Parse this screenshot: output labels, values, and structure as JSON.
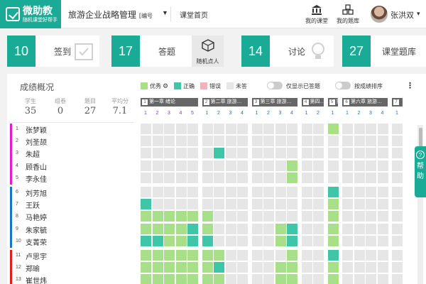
{
  "app": {
    "name": "微助教",
    "slogan": "随机课堂好帮手"
  },
  "header": {
    "course_title": "旅游企业战略管理",
    "course_title_suffix": "[编号",
    "home_label": "课堂首页",
    "my_classes": "我的课堂",
    "my_bank": "我的题库",
    "user_name": "张洪双"
  },
  "cards": [
    {
      "value": "10",
      "label": "签到"
    },
    {
      "value": "17",
      "label": "答题"
    },
    {
      "value": "14",
      "label": "讨论"
    },
    {
      "value": "27",
      "label": "课堂题库"
    }
  ],
  "random_pick": "随机点人",
  "overview": {
    "title": "成绩概况",
    "stats": [
      {
        "label": "学生",
        "value": "35"
      },
      {
        "label": "组卷",
        "value": "0"
      },
      {
        "label": "题目",
        "value": "27"
      },
      {
        "label": "平均分",
        "value": "7.1"
      }
    ]
  },
  "legend": [
    {
      "label": "优秀",
      "color": "#a8e08a"
    },
    {
      "label": "正确",
      "color": "#3ec6a8"
    },
    {
      "label": "错误",
      "color": "#f4b0bb"
    },
    {
      "label": "未答",
      "color": "#e6e6e6"
    }
  ],
  "toggles": [
    {
      "label": "仅显示已答题"
    },
    {
      "label": "按成绩排序"
    }
  ],
  "chapters": [
    {
      "badge": "1",
      "title": "第一章  绪论",
      "questions": [
        "1",
        "2",
        "3",
        "4",
        "5"
      ]
    },
    {
      "badge": "2",
      "title": "第二章  旅游…",
      "questions": [
        "1",
        "2",
        "3",
        "4"
      ]
    },
    {
      "badge": "3",
      "title": "第三章  旅游…",
      "questions": [
        "1",
        "2",
        "3",
        "4"
      ]
    },
    {
      "badge": "4",
      "title": "第四…",
      "questions": [
        "1",
        "2"
      ]
    },
    {
      "badge": "5",
      "title": "第五…",
      "questions": [
        "1"
      ]
    },
    {
      "badge": "6",
      "title": "第六章  旅游…",
      "questions": [
        "1",
        "2",
        "3",
        "4"
      ]
    },
    {
      "badge": "7",
      "title": "",
      "questions": [
        "1"
      ]
    }
  ],
  "question_colors": [
    "#7b3fc2",
    "#7b3fc2",
    "#7b3fc2",
    "#7b3fc2",
    "#7b3fc2",
    "#1a73c9",
    "#1a73c9",
    "#1a73c9",
    "#1a73c9",
    "#1a73c9",
    "#1a73c9",
    "#1a73c9",
    "#1a73c9",
    "#1a73c9",
    "#1a73c9",
    "#1a73c9",
    "#1a73c9",
    "#1a73c9",
    "#1a73c9",
    "#1a73c9",
    "#1a73c9"
  ],
  "students": [
    {
      "idx": "1",
      "name": "张梦颖",
      "group": "#e01fd0",
      "cells": "uuuuu|uuuu|uuuu|uuuu|e|uuuu|u"
    },
    {
      "idx": "2",
      "name": "刘圣颉",
      "group": "#e01fd0",
      "cells": "uuuuu|uuuu|uuuu|uuuu|u|uuuu|u"
    },
    {
      "idx": "3",
      "name": "朱超",
      "group": "#e01fd0",
      "cells": "uuuuu|ucuu|uuuu|uuuu|u|uuuu|u"
    },
    {
      "idx": "4",
      "name": "顾香山",
      "group": "#e01fd0",
      "cells": "uuuuu|uuuu|uuue|uuuu|u|uuuu|u"
    },
    {
      "idx": "5",
      "name": "李永佳",
      "group": "#e01fd0",
      "cells": "uuuuu|uuuu|uuue|uuuu|u|uuuu|u"
    },
    {
      "idx": "6",
      "name": "刘芳旭",
      "group": "#1a73c9",
      "cells": "uuuuu|uuuu|uuuu|uuuu|c|uuuu|u"
    },
    {
      "idx": "7",
      "name": "王跃",
      "group": "#1a73c9",
      "cells": "cuuuu|uuuu|uuuu|uuuu|e|uuuu|u"
    },
    {
      "idx": "8",
      "name": "马艳婷",
      "group": "#1a73c9",
      "cells": "eeeee|euuu|uuuu|uuuu|e|uuuu|u"
    },
    {
      "idx": "9",
      "name": "朱家毓",
      "group": "#1a73c9",
      "cells": "eeeec|euuu|uuec|uuuu|e|uuuu|u"
    },
    {
      "idx": "10",
      "name": "支菁荣",
      "group": "#1a73c9",
      "cells": "cceec|cuuu|uuec|uuuu|e|uuuu|u"
    },
    {
      "idx": "11",
      "name": "卢思宇",
      "group": "#e02020",
      "cells": "eeeee|eeuu|uuue|uuuu|c|uuuu|u"
    },
    {
      "idx": "12",
      "name": "郑瑜",
      "group": "#e02020",
      "cells": "eeeee|ecuu|uuee|uuuu|e|uuuu|u"
    },
    {
      "idx": "13",
      "name": "崔世炜",
      "group": "#e02020",
      "cells": "eeeee|eeuu|uuee|uuuu|e|uuuu|u"
    }
  ],
  "help_tab": "帮助"
}
